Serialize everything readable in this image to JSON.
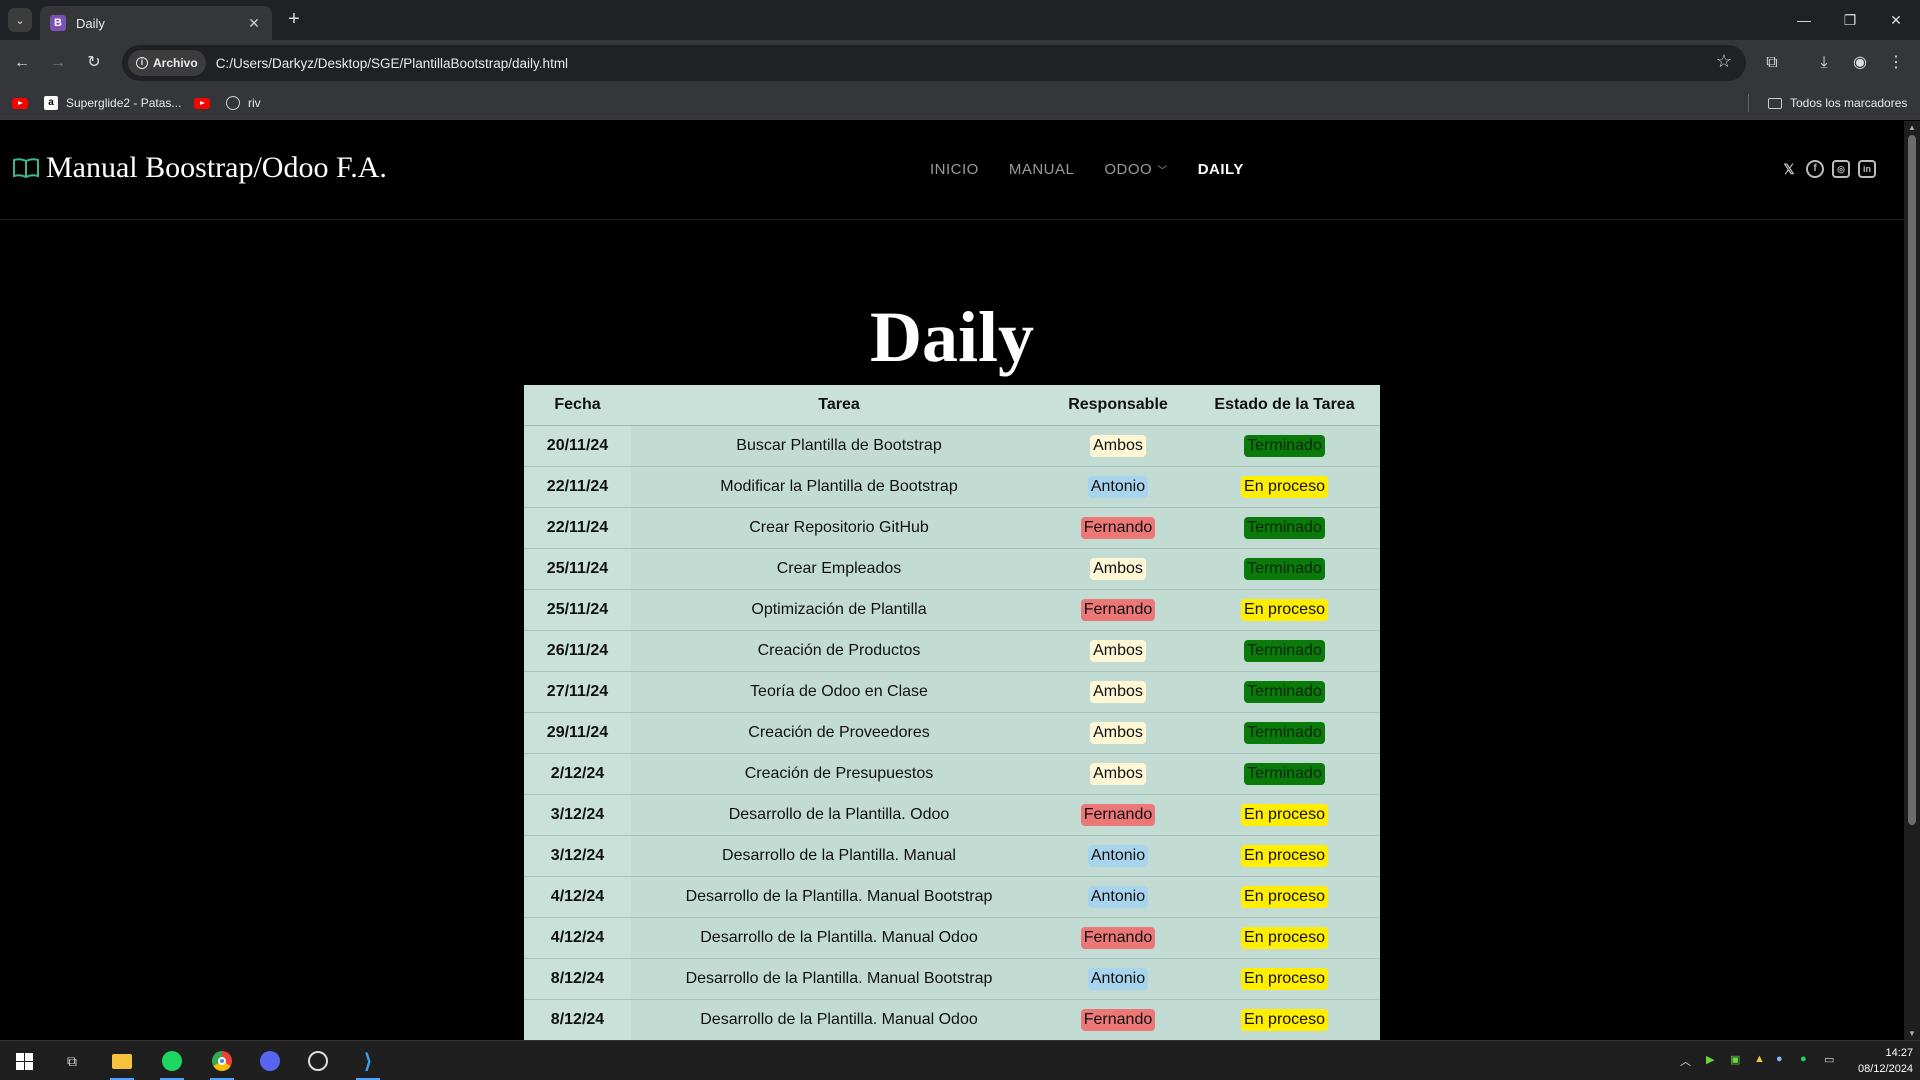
{
  "browser": {
    "tab_title": "Daily",
    "tab_favicon_letter": "B",
    "address_chip": "Archivo",
    "url": "C:/Users/Darkyz/Desktop/SGE/PlantillaBootstrap/daily.html",
    "bookmarks": [
      {
        "label": "",
        "icon": "youtube-icon"
      },
      {
        "label": "Superglide2 - Patas...",
        "icon": "amazon-icon"
      },
      {
        "label": "",
        "icon": "youtube-icon"
      },
      {
        "label": "riv",
        "icon": "globe-icon"
      }
    ],
    "all_bookmarks_label": "Todos los marcadores"
  },
  "site": {
    "logo_text": "Manual Boostrap/Odoo F.A.",
    "menu": [
      {
        "label": "INICIO",
        "active": false
      },
      {
        "label": "MANUAL",
        "active": false
      },
      {
        "label": "ODOO",
        "active": false,
        "dropdown": true
      },
      {
        "label": "DAILY",
        "active": true
      }
    ],
    "socials": [
      "x-icon",
      "facebook-icon",
      "instagram-icon",
      "linkedin-icon"
    ]
  },
  "page": {
    "title": "Daily",
    "table": {
      "headers": [
        "Fecha",
        "Tarea",
        "Responsable",
        "Estado de la Tarea"
      ],
      "rows": [
        {
          "fecha": "20/11/24",
          "tarea": "Buscar Plantilla de Bootstrap",
          "responsable": "Ambos",
          "estado": "Terminado"
        },
        {
          "fecha": "22/11/24",
          "tarea": "Modificar la Plantilla de Bootstrap",
          "responsable": "Antonio",
          "estado": "En proceso"
        },
        {
          "fecha": "22/11/24",
          "tarea": "Crear Repositorio GitHub",
          "responsable": "Fernando",
          "estado": "Terminado"
        },
        {
          "fecha": "25/11/24",
          "tarea": "Crear Empleados",
          "responsable": "Ambos",
          "estado": "Terminado"
        },
        {
          "fecha": "25/11/24",
          "tarea": "Optimización de Plantilla",
          "responsable": "Fernando",
          "estado": "En proceso"
        },
        {
          "fecha": "26/11/24",
          "tarea": "Creación de Productos",
          "responsable": "Ambos",
          "estado": "Terminado"
        },
        {
          "fecha": "27/11/24",
          "tarea": "Teoría de Odoo en Clase",
          "responsable": "Ambos",
          "estado": "Terminado"
        },
        {
          "fecha": "29/11/24",
          "tarea": "Creación de Proveedores",
          "responsable": "Ambos",
          "estado": "Terminado"
        },
        {
          "fecha": "2/12/24",
          "tarea": "Creación de Presupuestos",
          "responsable": "Ambos",
          "estado": "Terminado"
        },
        {
          "fecha": "3/12/24",
          "tarea": "Desarrollo de la Plantilla. Odoo",
          "responsable": "Fernando",
          "estado": "En proceso"
        },
        {
          "fecha": "3/12/24",
          "tarea": "Desarrollo de la Plantilla. Manual",
          "responsable": "Antonio",
          "estado": "En proceso"
        },
        {
          "fecha": "4/12/24",
          "tarea": "Desarrollo de la Plantilla. Manual Bootstrap",
          "responsable": "Antonio",
          "estado": "En proceso"
        },
        {
          "fecha": "4/12/24",
          "tarea": "Desarrollo de la Plantilla. Manual Odoo",
          "responsable": "Fernando",
          "estado": "En proceso"
        },
        {
          "fecha": "8/12/24",
          "tarea": "Desarrollo de la Plantilla. Manual Bootstrap",
          "responsable": "Antonio",
          "estado": "En proceso"
        },
        {
          "fecha": "8/12/24",
          "tarea": "Desarrollo de la Plantilla. Manual Odoo",
          "responsable": "Fernando",
          "estado": "En proceso"
        }
      ]
    }
  },
  "colors": {
    "responsable": {
      "Ambos": "#fef7d6",
      "Antonio": "#a8d4ee",
      "Fernando": "#ec7777"
    },
    "estado": {
      "Terminado": "#0a7a0a",
      "En proceso": "#ffee00"
    }
  },
  "taskbar": {
    "apps": [
      "windows-start-icon",
      "task-view-icon",
      "file-explorer-icon",
      "spotify-icon",
      "chrome-icon",
      "discord-icon",
      "obs-icon",
      "vscode-icon"
    ],
    "time": "14:27",
    "date": "08/12/2024"
  }
}
